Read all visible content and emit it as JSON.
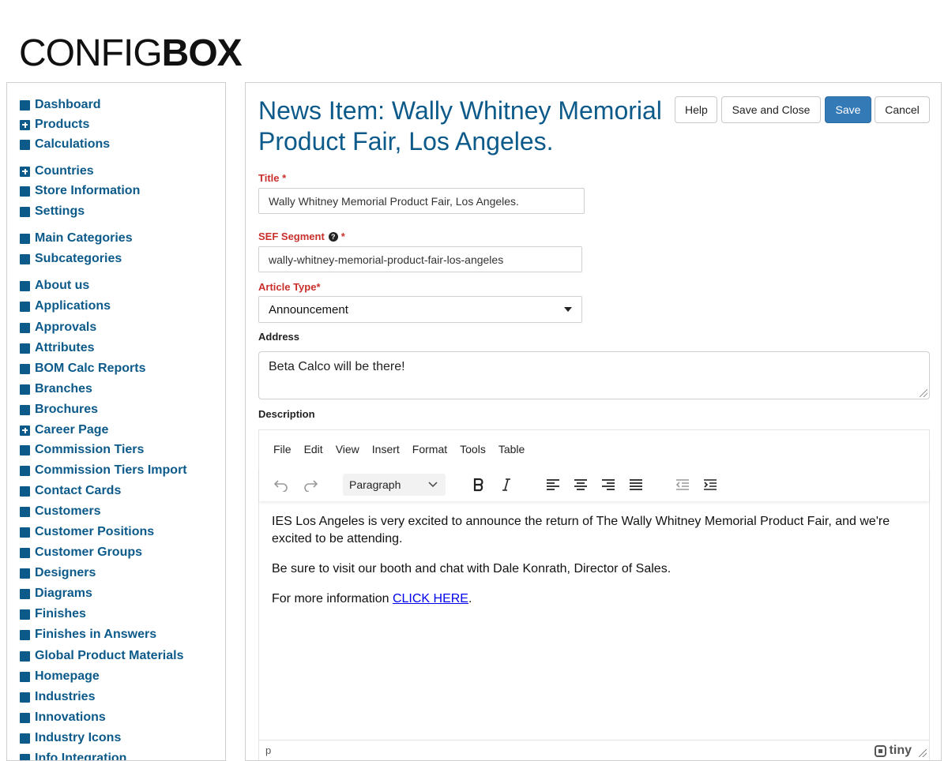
{
  "logo": {
    "part1": "CONFIG",
    "part2": "BOX"
  },
  "sidebar": {
    "items": [
      {
        "label": "Dashboard",
        "icon": "square-icon"
      },
      {
        "label": "Products",
        "icon": "plus-square-icon"
      },
      {
        "label": "Calculations",
        "icon": "square-icon"
      },
      {
        "label": "Countries",
        "icon": "plus-square-icon"
      },
      {
        "label": "Store Information",
        "icon": "square-icon"
      },
      {
        "label": "Settings",
        "icon": "square-icon"
      },
      {
        "label": "Main Categories",
        "icon": "square-icon"
      },
      {
        "label": "Subcategories",
        "icon": "square-icon"
      },
      {
        "label": "About us",
        "icon": "square-icon"
      },
      {
        "label": "Applications",
        "icon": "square-icon"
      },
      {
        "label": "Approvals",
        "icon": "square-icon"
      },
      {
        "label": "Attributes",
        "icon": "square-icon"
      },
      {
        "label": "BOM Calc Reports",
        "icon": "square-icon"
      },
      {
        "label": "Branches",
        "icon": "square-icon"
      },
      {
        "label": "Brochures",
        "icon": "square-icon"
      },
      {
        "label": "Career Page",
        "icon": "plus-square-icon"
      },
      {
        "label": "Commission Tiers",
        "icon": "square-icon"
      },
      {
        "label": "Commission Tiers Import",
        "icon": "square-icon"
      },
      {
        "label": "Contact Cards",
        "icon": "square-icon"
      },
      {
        "label": "Customers",
        "icon": "square-icon"
      },
      {
        "label": "Customer Positions",
        "icon": "square-icon"
      },
      {
        "label": "Customer Groups",
        "icon": "square-icon"
      },
      {
        "label": "Designers",
        "icon": "square-icon"
      },
      {
        "label": "Diagrams",
        "icon": "square-icon"
      },
      {
        "label": "Finishes",
        "icon": "square-icon"
      },
      {
        "label": "Finishes in Answers",
        "icon": "square-icon"
      },
      {
        "label": "Global Product Materials",
        "icon": "square-icon"
      },
      {
        "label": "Homepage",
        "icon": "square-icon"
      },
      {
        "label": "Industries",
        "icon": "square-icon"
      },
      {
        "label": "Innovations",
        "icon": "square-icon"
      },
      {
        "label": "Industry Icons",
        "icon": "square-icon"
      },
      {
        "label": "Info Integration",
        "icon": "square-icon"
      }
    ]
  },
  "header": {
    "title": "News Item: Wally Whitney Memorial Product Fair, Los Angeles.",
    "buttons": {
      "help": "Help",
      "save_close": "Save and Close",
      "save": "Save",
      "cancel": "Cancel"
    }
  },
  "form": {
    "title": {
      "label": "Title *",
      "value": "Wally Whitney Memorial Product Fair, Los Angeles."
    },
    "sef": {
      "label": "SEF Segment",
      "required_mark": "*",
      "help_icon": "question-circle-icon",
      "help_glyph": "?",
      "value": "wally-whitney-memorial-product-fair-los-angeles"
    },
    "article_type": {
      "label": "Article Type*",
      "selected": "Announcement"
    },
    "address": {
      "label": "Address",
      "value": "Beta Calco will be there!"
    },
    "description": {
      "label": "Description"
    }
  },
  "editor": {
    "menus": [
      "File",
      "Edit",
      "View",
      "Insert",
      "Format",
      "Tools",
      "Table"
    ],
    "block_format": "Paragraph",
    "paragraphs": {
      "p1": "IES Los Angeles is very excited to announce the return of The Wally Whitney Memorial Product Fair, and we're excited to be attending.",
      "p2": "Be sure to visit our booth and chat with Dale Konrath, Director of Sales.",
      "p3_prefix": "For more information ",
      "p3_link": "CLICK HERE",
      "p3_suffix": "."
    },
    "path": "p",
    "brand": "tiny"
  },
  "colors": {
    "accent": "#0c5a8a",
    "primary_button": "#337ab7",
    "required": "#c9302c",
    "link": "#0000ee"
  }
}
